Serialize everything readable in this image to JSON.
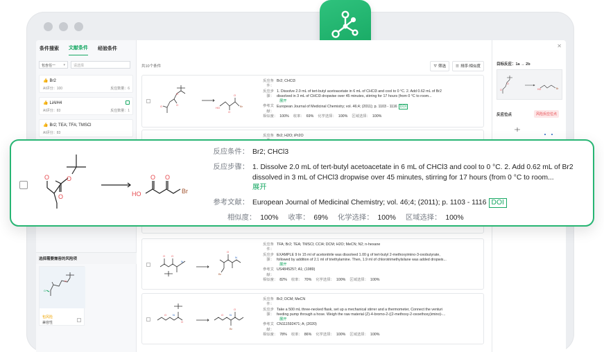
{
  "left": {
    "tabs": [
      "条件搜索",
      "文献条件",
      "经验条件"
    ],
    "filter": {
      "select": "包含任一",
      "search_placeholder": "请选择"
    },
    "conditions": [
      {
        "name": "Br2",
        "score": "AI评分：100",
        "count": "反应数量：6"
      },
      {
        "name": "LiAlH4",
        "score": "AI评分：83",
        "count": "反应数量：1"
      },
      {
        "name": "Br2; TEA; TFA; TMSCl",
        "score": "AI评分：83",
        "count": ""
      }
    ],
    "risk": {
      "title": "选择需要兼容的风险项",
      "label1": "包风险",
      "label2": "兼容性"
    }
  },
  "middle": {
    "count": "共10个条件",
    "filter_btn": "筛选",
    "sort_btn": "排序:相似度",
    "rows": [
      {
        "cond_k": "反应条件：",
        "cond": "Br2; CHCl3",
        "step_k": "反应步骤：",
        "step1": "1. Dissolve 2.0 mL of tert-butyl acetoacetate in 6 mL of CHCl3 and cool to 0 °C. 2. Add 0.62 mL of Br2",
        "step2": "dissolved in 3 mL of CHCl3 dropwise over 45 minutes, stirring for 17 hours (from 0 °C to room...",
        "expand": "展开",
        "ref_k": "参考文献：",
        "ref": "European Journal of Medicinal Chemistry; vol. 46;4; (2011); p. 1103 - 1116",
        "doi": "DOI",
        "m": [
          "相似度：",
          "100%",
          "收率：",
          "69%",
          "化学选择：",
          "100%",
          "区域选择：",
          "100%"
        ]
      },
      {
        "cond_k": "反应条件：",
        "cond": "Br2; H2O; iPr2O"
      },
      {
        "cond_k": "反应条件：",
        "cond": "TFA; Br2; TEA; TMSCl; CCl4; DCM; H2O; MeCN; N2; n-hexane",
        "step_k": "反应步骤：",
        "step1": "EXAMPLE 9 In 15 ml of acetonitrile was dissolved 1.00 g of tert-butyl 2-methoxyimino-3-oxobutyrate,",
        "step2": "followed by addition of 2.1 ml of triethylamine. Then, 1.9 ml of chlorotrimethylsilane was added dropwis...",
        "expand": "展开",
        "ref_k": "参考文献：",
        "ref": "US4845257; A1; (1989)",
        "m": [
          "相似度：",
          "82%",
          "收率：",
          "70%",
          "化学选择：",
          "100%",
          "区域选择：",
          "100%"
        ]
      },
      {
        "cond_k": "反应条件：",
        "cond": "Br2; DCM; MeCN",
        "step_k": "反应步骤：",
        "step1": "Take a 500 mL three-necked flask, set up a mechanical stirrer and a thermometer, Connect the venturi",
        "step2": "feeding pump through a hose. Weigh the raw material (Z)-4-bromo-2-((2-methoxy-2-oxoethoxy)imino)-...",
        "expand": "展开",
        "ref_k": "参考文献：",
        "ref": "CN111592471; A; (2020)",
        "m": [
          "相似度：",
          "78%",
          "收率：",
          "86%",
          "化学选择：",
          "100%",
          "区域选择：",
          "100%"
        ]
      }
    ]
  },
  "right": {
    "target_title": "目标反应：1a → 2b",
    "site_title": "反应位点",
    "risk_badge": "风险反应位点"
  },
  "zoom": {
    "cond_k": "反应条件：",
    "cond": "Br2; CHCl3",
    "step_k": "反应步骤：",
    "step1": "1. Dissolve 2.0 mL of tert-butyl acetoacetate in 6 mL of CHCl3 and cool to 0 °C. 2. Add 0.62 mL of Br2",
    "step2": "dissolved in 3 mL of CHCl3 dropwise over 45 minutes, stirring for 17 hours (from 0 °C to room...",
    "expand": "展开",
    "ref_k": "参考文献：",
    "ref": "European Journal of Medicinal Chemistry; vol. 46;4; (2011); p. 1103 - 1116",
    "doi": "DOI",
    "m": [
      "相似度：",
      "100%",
      "收率：",
      "69%",
      "化学选择：",
      "100%",
      "区域选择：",
      "100%"
    ],
    "atom_o1": "O",
    "atom_o2": "O",
    "atom_o3": "O",
    "atom_ho": "HO",
    "atom_o4": "O",
    "atom_o5": "O",
    "atom_br": "Br"
  },
  "colors": {
    "accent": "#17a863",
    "risk": "#e5484d",
    "warn": "#f0a500"
  }
}
